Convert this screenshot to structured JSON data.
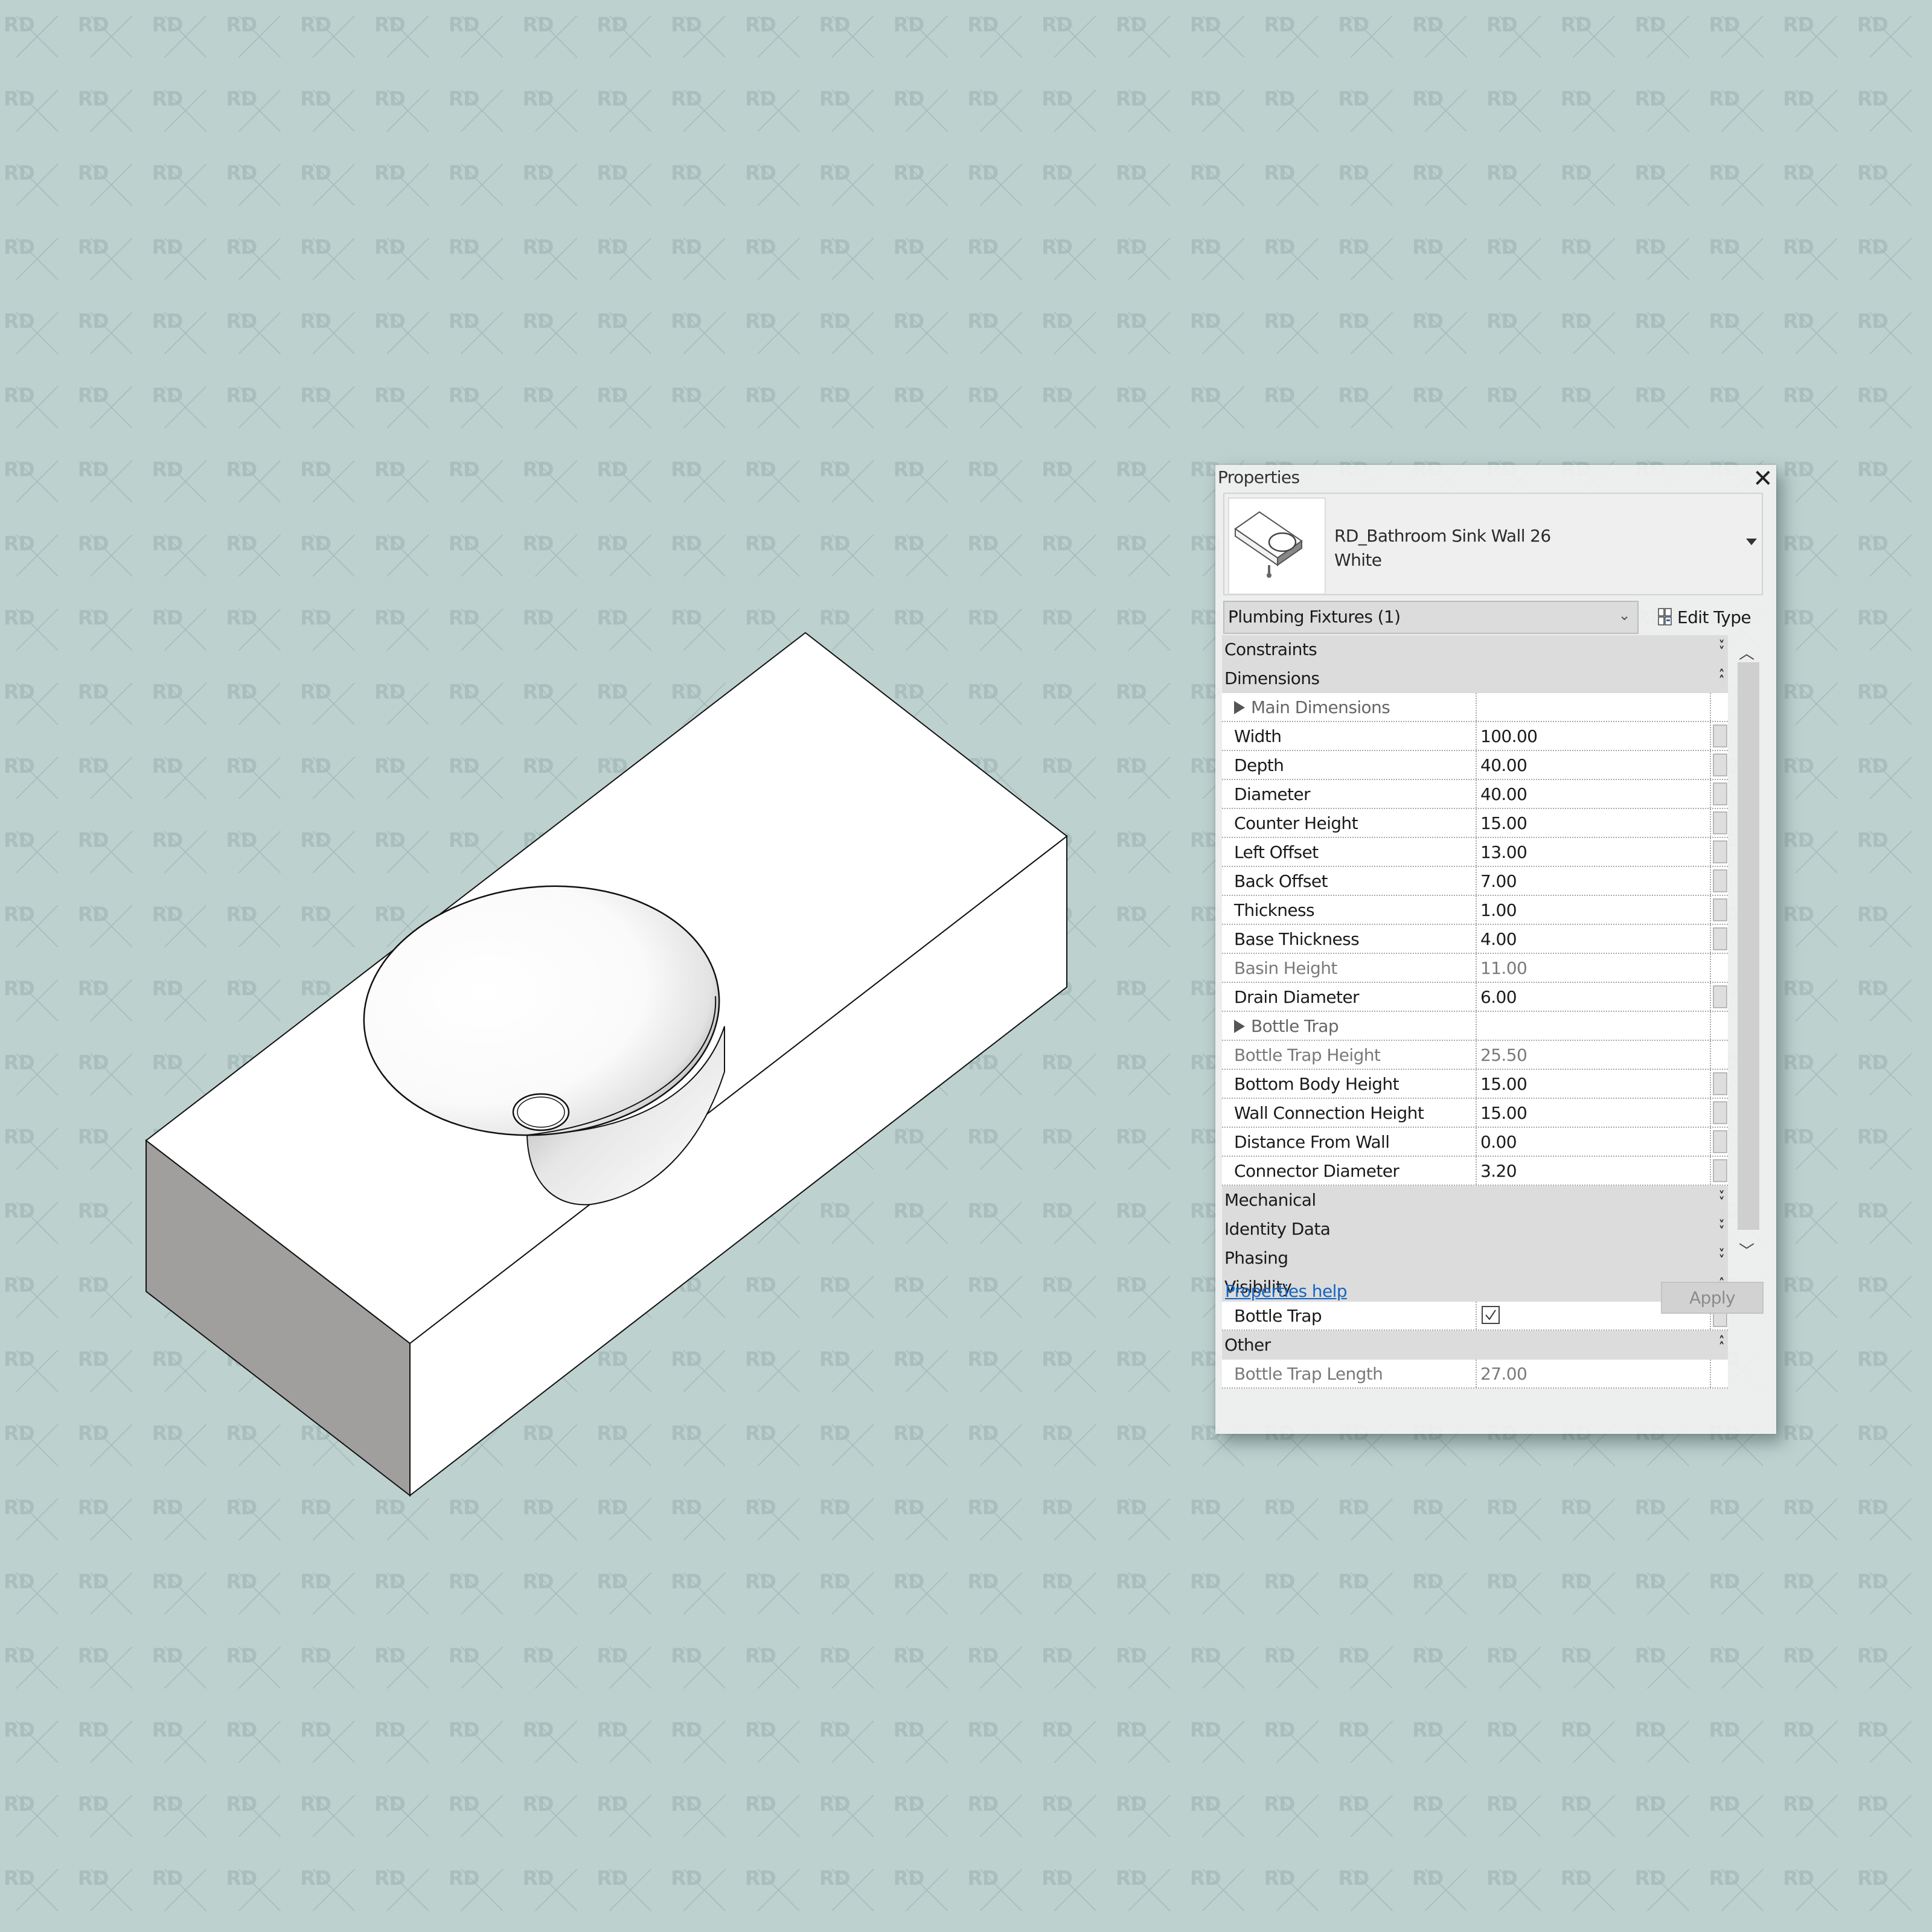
{
  "background": {
    "color": "#bdd1cf",
    "watermark_text": "RD",
    "watermark_color": "#a9bfbd"
  },
  "viewport": {
    "model_name": "RD_Bathroom Sink Wall 26 White",
    "model_color": "#ffffff",
    "pipe_color": "#6e6e6e"
  },
  "properties_panel": {
    "title": "Properties",
    "close_icon": "close-icon",
    "type_selector": {
      "name_line1": "RD_Bathroom Sink Wall 26",
      "name_line2": "White",
      "thumbnail_icon": "sink-thumbnail-icon",
      "dropdown_icon": "caret-down-icon"
    },
    "filter": {
      "value": "Plumbing Fixtures (1)",
      "dropdown_icon": "chevron-down-icon"
    },
    "edit_type_label": "Edit Type",
    "groups": [
      {
        "label": "Constraints",
        "expanded": false,
        "rows": []
      },
      {
        "label": "Dimensions",
        "expanded": true,
        "rows": [
          {
            "name": "Main Dimensions",
            "value": "",
            "kind": "subheader"
          },
          {
            "name": "Width",
            "value": "100.00",
            "editable": true
          },
          {
            "name": "Depth",
            "value": "40.00",
            "editable": true
          },
          {
            "name": "Diameter",
            "value": "40.00",
            "editable": true
          },
          {
            "name": "Counter Height",
            "value": "15.00",
            "editable": true
          },
          {
            "name": "Left Offset",
            "value": "13.00",
            "editable": true
          },
          {
            "name": "Back Offset",
            "value": "7.00",
            "editable": true
          },
          {
            "name": "Thickness",
            "value": "1.00",
            "editable": true
          },
          {
            "name": "Base Thickness",
            "value": "4.00",
            "editable": true
          },
          {
            "name": "Basin Height",
            "value": "11.00",
            "editable": false
          },
          {
            "name": "Drain Diameter",
            "value": "6.00",
            "editable": true
          },
          {
            "name": "Bottle Trap",
            "value": "",
            "kind": "subheader"
          },
          {
            "name": "Bottle Trap Height",
            "value": "25.50",
            "editable": false
          },
          {
            "name": "Bottom Body Height",
            "value": "15.00",
            "editable": true
          },
          {
            "name": "Wall Connection Height",
            "value": "15.00",
            "editable": true
          },
          {
            "name": "Distance From Wall",
            "value": "0.00",
            "editable": true
          },
          {
            "name": "Connector Diameter",
            "value": "3.20",
            "editable": true
          }
        ]
      },
      {
        "label": "Mechanical",
        "expanded": false,
        "rows": []
      },
      {
        "label": "Identity Data",
        "expanded": false,
        "rows": []
      },
      {
        "label": "Phasing",
        "expanded": false,
        "rows": []
      },
      {
        "label": "Visibility",
        "expanded": true,
        "rows": [
          {
            "name": "Bottle Trap",
            "value": "checked",
            "kind": "checkbox",
            "editable": true
          }
        ]
      },
      {
        "label": "Other",
        "expanded": true,
        "rows": [
          {
            "name": "Bottle Trap Length",
            "value": "27.00",
            "editable": false
          }
        ]
      }
    ],
    "help_link": "Properties help",
    "apply_label": "Apply"
  }
}
